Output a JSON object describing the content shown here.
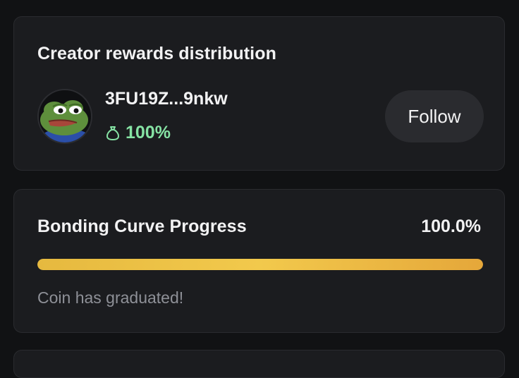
{
  "creator_card": {
    "title": "Creator rewards distribution",
    "address": "3FU19Z...9nkw",
    "share": "100%",
    "follow_label": "Follow",
    "share_icon": "money-bag-icon",
    "avatar": "pepe-frog-avatar"
  },
  "bonding_card": {
    "title": "Bonding Curve Progress",
    "value": "100.0%",
    "progress": 100,
    "status": "Coin has graduated!"
  },
  "colors": {
    "background": "#111214",
    "card": "#1b1c1f",
    "accent_green": "#86e3a4",
    "progress_gold": "#f2c94c",
    "muted_text": "#8e9097"
  }
}
